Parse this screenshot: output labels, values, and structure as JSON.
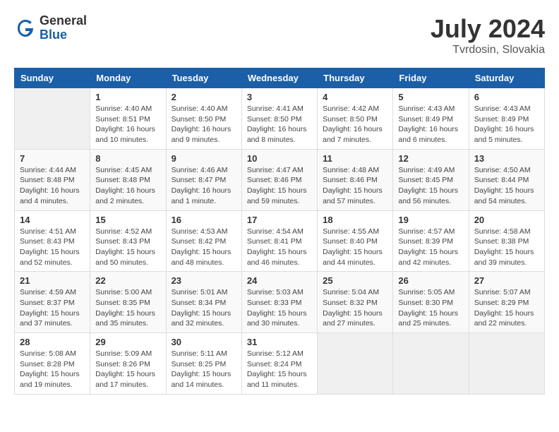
{
  "header": {
    "logo_general": "General",
    "logo_blue": "Blue",
    "month_title": "July 2024",
    "location": "Tvrdosin, Slovakia"
  },
  "calendar": {
    "days_of_week": [
      "Sunday",
      "Monday",
      "Tuesday",
      "Wednesday",
      "Thursday",
      "Friday",
      "Saturday"
    ],
    "weeks": [
      [
        {
          "day": "",
          "info": ""
        },
        {
          "day": "1",
          "info": "Sunrise: 4:40 AM\nSunset: 8:51 PM\nDaylight: 16 hours\nand 10 minutes."
        },
        {
          "day": "2",
          "info": "Sunrise: 4:40 AM\nSunset: 8:50 PM\nDaylight: 16 hours\nand 9 minutes."
        },
        {
          "day": "3",
          "info": "Sunrise: 4:41 AM\nSunset: 8:50 PM\nDaylight: 16 hours\nand 8 minutes."
        },
        {
          "day": "4",
          "info": "Sunrise: 4:42 AM\nSunset: 8:50 PM\nDaylight: 16 hours\nand 7 minutes."
        },
        {
          "day": "5",
          "info": "Sunrise: 4:43 AM\nSunset: 8:49 PM\nDaylight: 16 hours\nand 6 minutes."
        },
        {
          "day": "6",
          "info": "Sunrise: 4:43 AM\nSunset: 8:49 PM\nDaylight: 16 hours\nand 5 minutes."
        }
      ],
      [
        {
          "day": "7",
          "info": "Sunrise: 4:44 AM\nSunset: 8:48 PM\nDaylight: 16 hours\nand 4 minutes."
        },
        {
          "day": "8",
          "info": "Sunrise: 4:45 AM\nSunset: 8:48 PM\nDaylight: 16 hours\nand 2 minutes."
        },
        {
          "day": "9",
          "info": "Sunrise: 4:46 AM\nSunset: 8:47 PM\nDaylight: 16 hours\nand 1 minute."
        },
        {
          "day": "10",
          "info": "Sunrise: 4:47 AM\nSunset: 8:46 PM\nDaylight: 15 hours\nand 59 minutes."
        },
        {
          "day": "11",
          "info": "Sunrise: 4:48 AM\nSunset: 8:46 PM\nDaylight: 15 hours\nand 57 minutes."
        },
        {
          "day": "12",
          "info": "Sunrise: 4:49 AM\nSunset: 8:45 PM\nDaylight: 15 hours\nand 56 minutes."
        },
        {
          "day": "13",
          "info": "Sunrise: 4:50 AM\nSunset: 8:44 PM\nDaylight: 15 hours\nand 54 minutes."
        }
      ],
      [
        {
          "day": "14",
          "info": "Sunrise: 4:51 AM\nSunset: 8:43 PM\nDaylight: 15 hours\nand 52 minutes."
        },
        {
          "day": "15",
          "info": "Sunrise: 4:52 AM\nSunset: 8:43 PM\nDaylight: 15 hours\nand 50 minutes."
        },
        {
          "day": "16",
          "info": "Sunrise: 4:53 AM\nSunset: 8:42 PM\nDaylight: 15 hours\nand 48 minutes."
        },
        {
          "day": "17",
          "info": "Sunrise: 4:54 AM\nSunset: 8:41 PM\nDaylight: 15 hours\nand 46 minutes."
        },
        {
          "day": "18",
          "info": "Sunrise: 4:55 AM\nSunset: 8:40 PM\nDaylight: 15 hours\nand 44 minutes."
        },
        {
          "day": "19",
          "info": "Sunrise: 4:57 AM\nSunset: 8:39 PM\nDaylight: 15 hours\nand 42 minutes."
        },
        {
          "day": "20",
          "info": "Sunrise: 4:58 AM\nSunset: 8:38 PM\nDaylight: 15 hours\nand 39 minutes."
        }
      ],
      [
        {
          "day": "21",
          "info": "Sunrise: 4:59 AM\nSunset: 8:37 PM\nDaylight: 15 hours\nand 37 minutes."
        },
        {
          "day": "22",
          "info": "Sunrise: 5:00 AM\nSunset: 8:35 PM\nDaylight: 15 hours\nand 35 minutes."
        },
        {
          "day": "23",
          "info": "Sunrise: 5:01 AM\nSunset: 8:34 PM\nDaylight: 15 hours\nand 32 minutes."
        },
        {
          "day": "24",
          "info": "Sunrise: 5:03 AM\nSunset: 8:33 PM\nDaylight: 15 hours\nand 30 minutes."
        },
        {
          "day": "25",
          "info": "Sunrise: 5:04 AM\nSunset: 8:32 PM\nDaylight: 15 hours\nand 27 minutes."
        },
        {
          "day": "26",
          "info": "Sunrise: 5:05 AM\nSunset: 8:30 PM\nDaylight: 15 hours\nand 25 minutes."
        },
        {
          "day": "27",
          "info": "Sunrise: 5:07 AM\nSunset: 8:29 PM\nDaylight: 15 hours\nand 22 minutes."
        }
      ],
      [
        {
          "day": "28",
          "info": "Sunrise: 5:08 AM\nSunset: 8:28 PM\nDaylight: 15 hours\nand 19 minutes."
        },
        {
          "day": "29",
          "info": "Sunrise: 5:09 AM\nSunset: 8:26 PM\nDaylight: 15 hours\nand 17 minutes."
        },
        {
          "day": "30",
          "info": "Sunrise: 5:11 AM\nSunset: 8:25 PM\nDaylight: 15 hours\nand 14 minutes."
        },
        {
          "day": "31",
          "info": "Sunrise: 5:12 AM\nSunset: 8:24 PM\nDaylight: 15 hours\nand 11 minutes."
        },
        {
          "day": "",
          "info": ""
        },
        {
          "day": "",
          "info": ""
        },
        {
          "day": "",
          "info": ""
        }
      ]
    ]
  }
}
